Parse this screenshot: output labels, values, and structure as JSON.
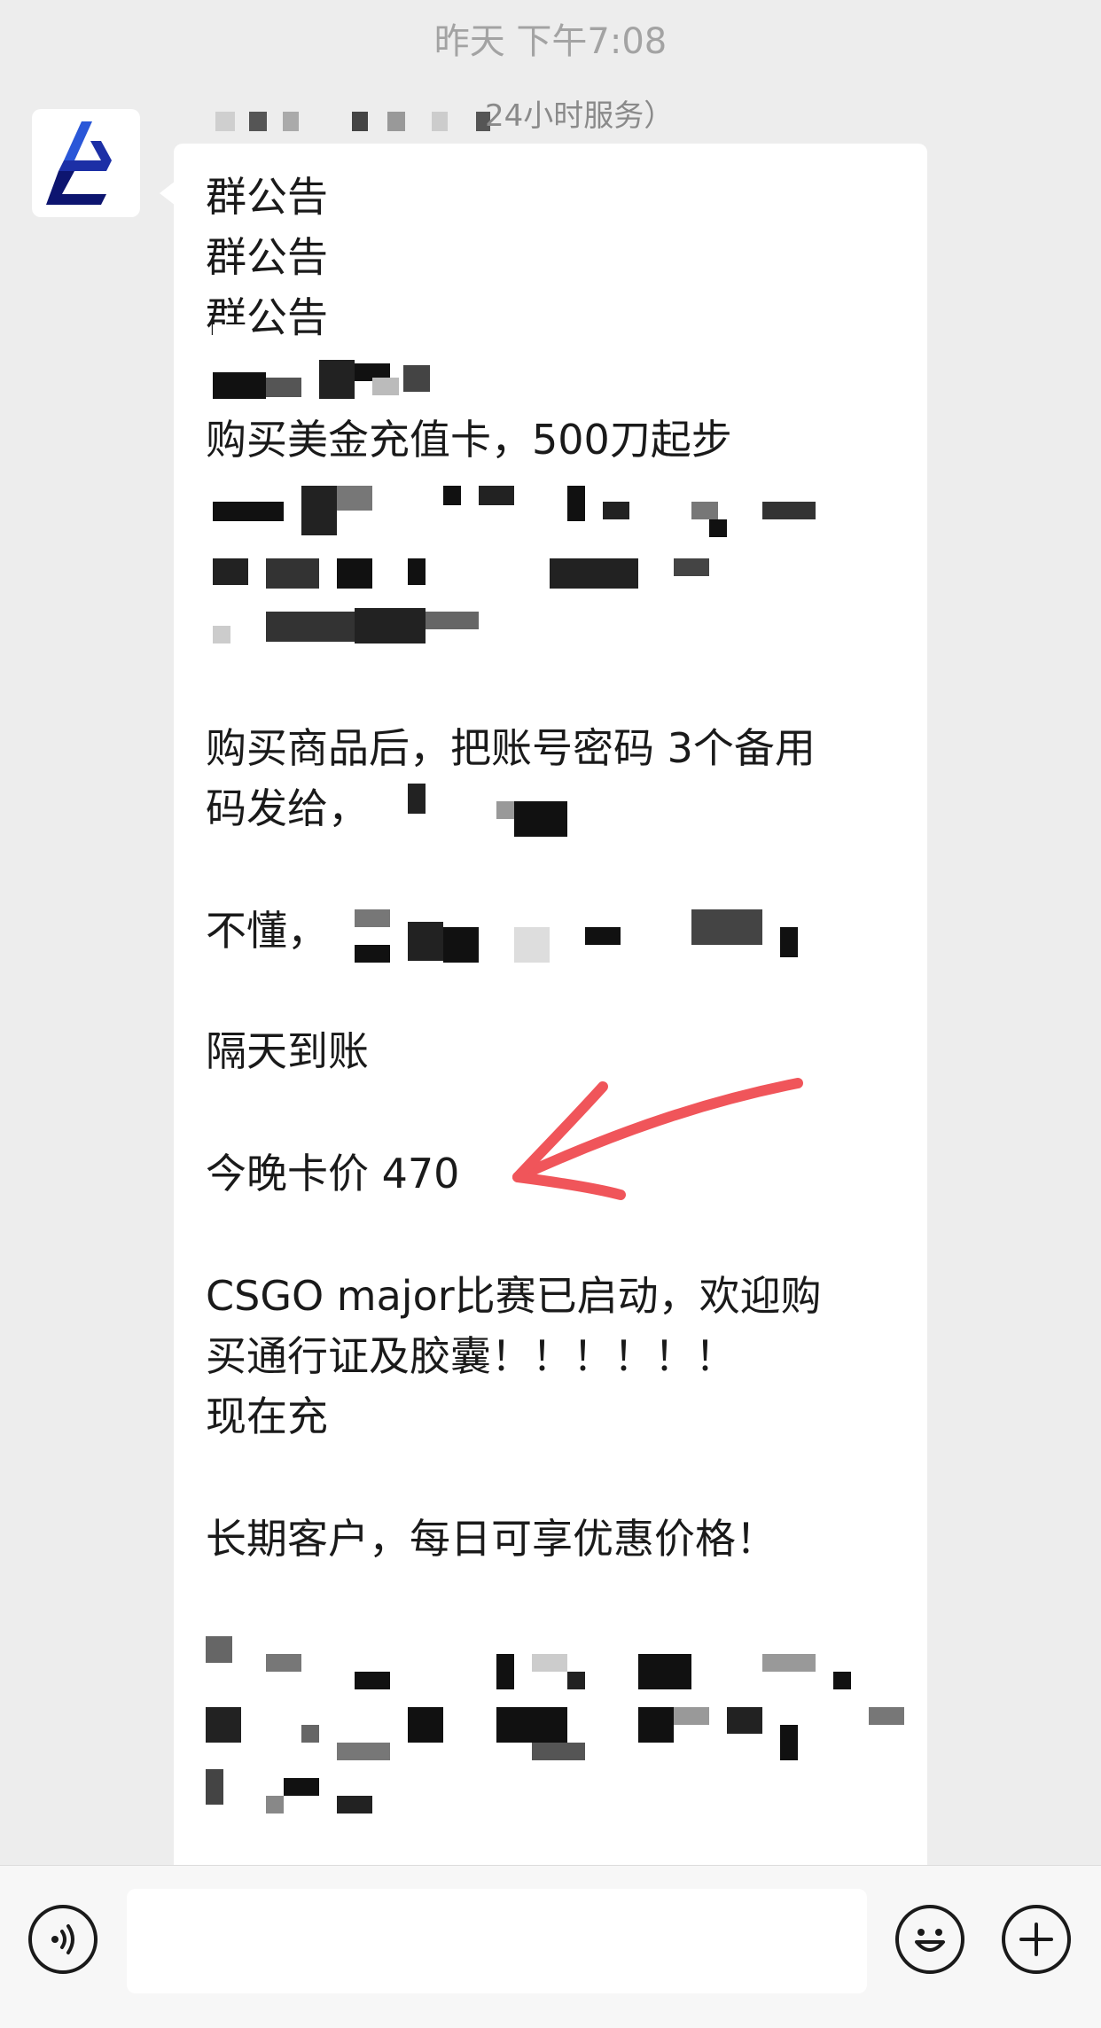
{
  "chat": {
    "timestamp": "昨天 下午7:08",
    "sender_name": "24小时服务）"
  },
  "message": {
    "lines": [
      "群公告",
      "群公告",
      "群公告",
      "购买美金充值卡，500刀起步",
      "购买商品后，把账号密码 3个备用",
      "码发给，",
      "不懂，",
      "隔天到账",
      "今晚卡价 470",
      "CSGO major比赛已启动，欢迎购",
      "买通行证及胶囊！！！！！！",
      "现在充",
      "长期客户，每日可享优惠价格！"
    ]
  },
  "annotation": {
    "arrow_color": "#f0555a"
  },
  "composer": {
    "placeholder": ""
  },
  "icons": {
    "voice": "voice-icon",
    "emoji": "emoji-icon",
    "plus": "plus-icon"
  }
}
